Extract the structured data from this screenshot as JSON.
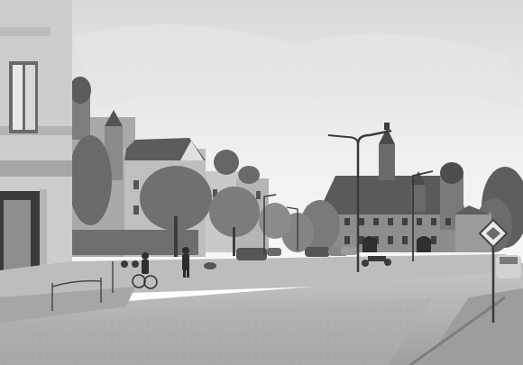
{
  "photo": {
    "description_style": "monochrome sepia street scene",
    "tone": "sepia-grayscale"
  },
  "palette": {
    "sky": "#f1f1f1",
    "sky_top": "#dcdcdc",
    "building_light": "#d8d8d8",
    "building_mid": "#9a9a9a",
    "building_dark": "#4a4a4a",
    "roof": "#5a5a5a",
    "tree": "#6f6f6f",
    "road": "#b8b8b8",
    "pavement": "#a9a9a9",
    "curb": "#8c8c8c"
  }
}
